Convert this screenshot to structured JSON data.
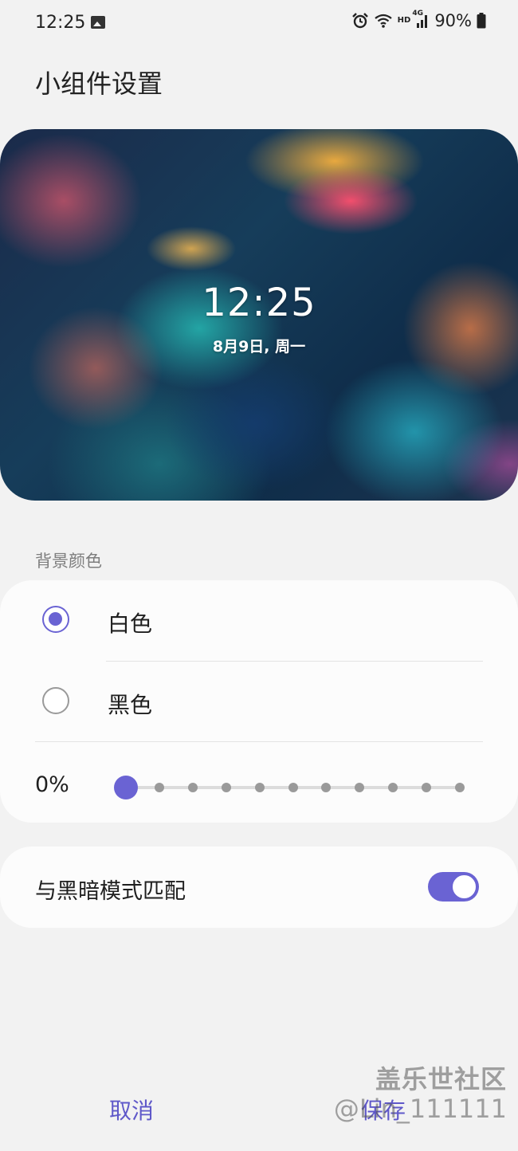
{
  "status_bar": {
    "time": "12:25",
    "hd_label": "HD",
    "network_label": "4G",
    "battery": "90%",
    "icons": [
      "image-icon",
      "alarm-icon",
      "wifi-icon",
      "signal-icon",
      "battery-icon"
    ]
  },
  "page": {
    "title": "小组件设置"
  },
  "preview": {
    "time": "12:25",
    "date": "8月9日, 周一"
  },
  "background_color": {
    "header": "背景颜色",
    "options": [
      {
        "label": "白色",
        "selected": true
      },
      {
        "label": "黑色",
        "selected": false
      }
    ],
    "transparency_label": "0%",
    "transparency_value": 0,
    "transparency_steps": 11
  },
  "dark_mode": {
    "label": "与黑暗模式匹配",
    "enabled": true
  },
  "actions": {
    "cancel": "取消",
    "save": "保存"
  },
  "watermark": {
    "brand": "盖乐世社区",
    "user": "@Lin_111111"
  },
  "colors": {
    "accent": "#6a63d3",
    "background": "#f2f2f2",
    "card": "#fcfcfc",
    "secondary_text": "#7d7d7d"
  }
}
